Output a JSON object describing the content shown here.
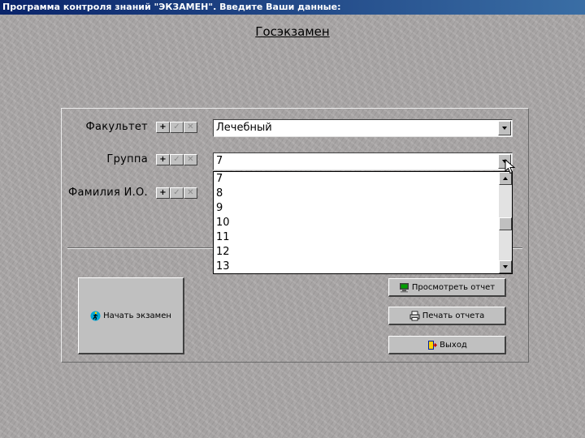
{
  "window": {
    "title": "Программа контроля знаний \"ЭКЗАМЕН\". Введите Ваши данные:"
  },
  "header": {
    "title": "Госэкзамен"
  },
  "fields": {
    "faculty": {
      "label": "Факультет",
      "value": "Лечебный"
    },
    "group": {
      "label": "Группа",
      "value": "7",
      "options": [
        "7",
        "8",
        "9",
        "10",
        "11",
        "12",
        "13"
      ]
    },
    "name": {
      "label": "Фамилия И.О."
    }
  },
  "navigator": {
    "add": "+",
    "post": "✓",
    "cancel": "✕"
  },
  "buttons": {
    "start_exam": "Начать экзамен",
    "view_report": "Просмотреть отчет",
    "print_report": "Печать отчета",
    "exit": "Выход"
  },
  "icons": {
    "start_exam": "running-man-icon",
    "view_report": "monitor-icon",
    "print_report": "printer-icon",
    "exit": "exit-door-icon"
  }
}
